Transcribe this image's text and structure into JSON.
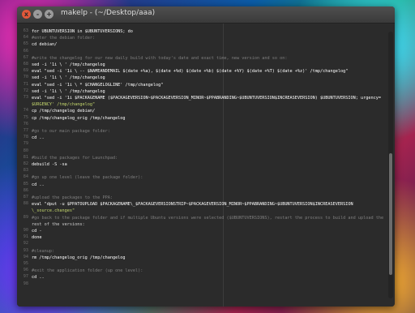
{
  "window": {
    "title": "makelp - (~/Desktop/aaa)",
    "buttons": {
      "close": "x",
      "minimize": "-",
      "maximize": "+"
    }
  },
  "lines": [
    {
      "n": "63",
      "t": "for UBUNTUVERSION in $UBUNTUVERSIONS; do"
    },
    {
      "n": "64",
      "t": "    #enter the debian folder:"
    },
    {
      "n": "65",
      "t": "    cd debian/"
    },
    {
      "n": "66",
      "t": ""
    },
    {
      "n": "67",
      "t": "    #write the changelog for our new daily build with today's date and exact time, new version and so on:"
    },
    {
      "n": "68",
      "t": "    sed -i '1i \\ ' /tmp/changelog"
    },
    {
      "n": "69",
      "t": "    eval \"sed -i '1i \\ -- $NAMEANDEMAIL  $(date +%a), $(date +%d) $(date +%b) $(date +%Y) $(date +%T) $(date +%z)' /tmp/changelog\""
    },
    {
      "n": "70",
      "t": "    sed -i '1i \\ ' /tmp/changelog"
    },
    {
      "n": "71",
      "t": "    eval \"sed -i '1i \\ * $CHANGELOGLINE' /tmp/changelog\""
    },
    {
      "n": "72",
      "t": "    sed -i '1i \\ ' /tmp/changelog"
    },
    {
      "n": "73",
      "t": "    eval \"sed -i '1i $PACKAGENAME ($PACKAGEVERSION~$PACKAGEVERSION_MINOR~$PPABRANDING~$UBUNTUVERSION$INCREASEVERSION) $UBUNTUVERSION; urgency="
    },
    {
      "n": "",
      "t": "$URGENCY' /tmp/changelog\""
    },
    {
      "n": "74",
      "t": "    cp /tmp/changelog debian/"
    },
    {
      "n": "75",
      "t": "    cp /tmp/changelog_orig /tmp/changelog"
    },
    {
      "n": "76",
      "t": ""
    },
    {
      "n": "77",
      "t": "    #go to our main package folder:"
    },
    {
      "n": "78",
      "t": "    cd .."
    },
    {
      "n": "79",
      "t": ""
    },
    {
      "n": "80",
      "t": ""
    },
    {
      "n": "81",
      "t": "    #build the packages for Launchpad:"
    },
    {
      "n": "82",
      "t": "    debuild -S -sa"
    },
    {
      "n": "83",
      "t": ""
    },
    {
      "n": "84",
      "t": "    #go up one level (leave the package folder):"
    },
    {
      "n": "85",
      "t": "    cd .."
    },
    {
      "n": "86",
      "t": ""
    },
    {
      "n": "87",
      "t": "    #upload the packages to the PPA:"
    },
    {
      "n": "88",
      "t": "    eval \"dput -u $PPATOUPLOAD $PACKAGENAME\\_$PACKAGEVERSIONSTRIP~$PACKAGEVERSION_MINOR~$PPABRANDING~$UBUNTUVERSION$INCREASEVERSION"
    },
    {
      "n": "",
      "t": "\\_source.changes\""
    },
    {
      "n": "89",
      "t": "    #go back to the package folder and if multiple Ubuntu versions were selected ($UBUNTUVERSIONS), restart the process to build and upload the"
    },
    {
      "n": "",
      "t": "rest of the versions:"
    },
    {
      "n": "90",
      "t": "    cd -"
    },
    {
      "n": "91",
      "t": "done"
    },
    {
      "n": "92",
      "t": ""
    },
    {
      "n": "93",
      "t": "#cleanup:"
    },
    {
      "n": "94",
      "t": "rm /tmp/changelog_orig /tmp/changelog"
    },
    {
      "n": "95",
      "t": ""
    },
    {
      "n": "96",
      "t": "#exit the application folder (up one level):"
    },
    {
      "n": "97",
      "t": "cd .."
    },
    {
      "n": "98",
      "t": ""
    }
  ]
}
